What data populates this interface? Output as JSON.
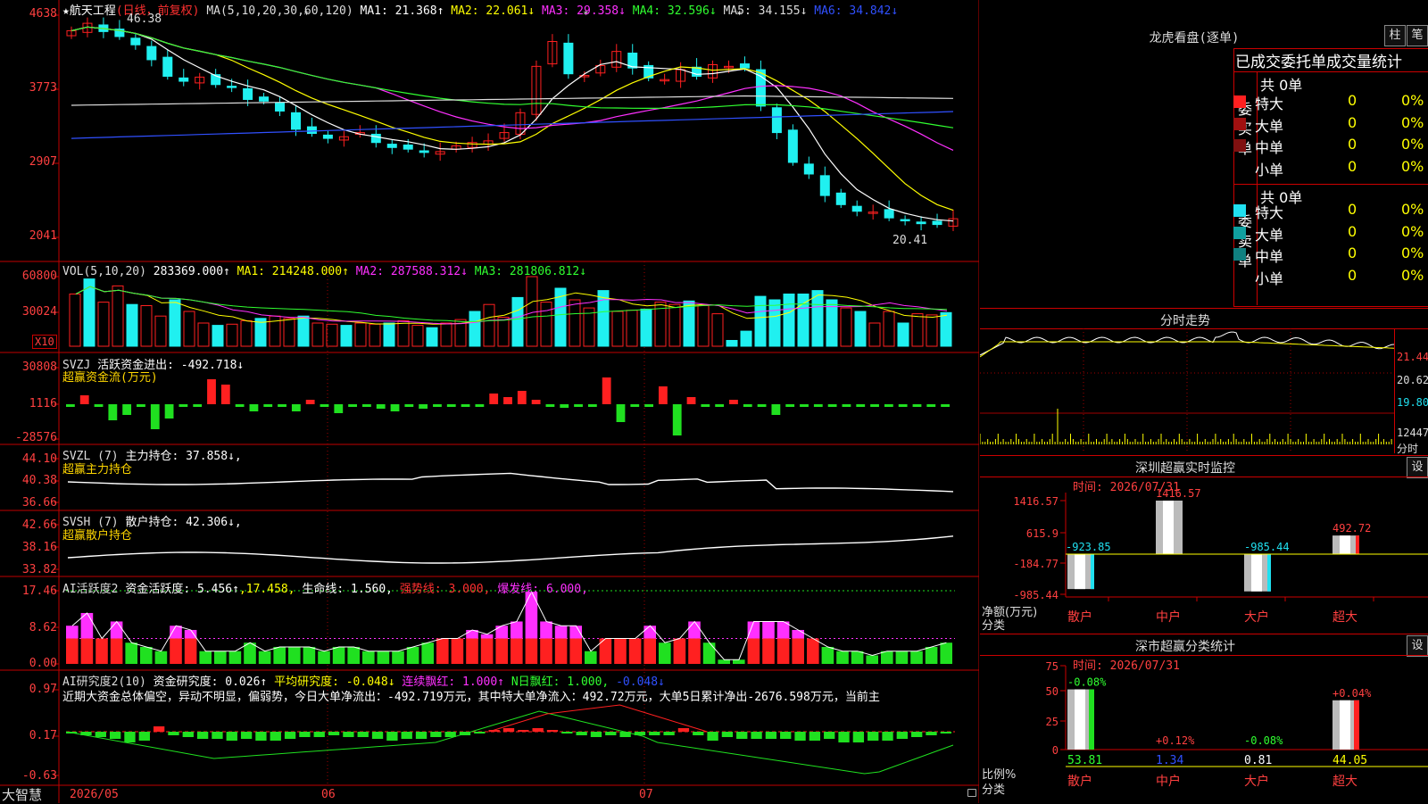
{
  "app": {
    "logo": "大智慧"
  },
  "main_chart": {
    "title_star": "★",
    "stock_name": "航天工程",
    "period": "(日线，前复权)",
    "ma_label": "MA(5,10,20,30,60,120)",
    "ma1": "MA1: 21.368↑",
    "ma2": "MA2: 22.061↓",
    "ma3": "MA3: 29.358↓",
    "ma4": "MA4: 32.596↓",
    "ma5": "MA5: 34.155↓",
    "ma6": "MA6: 34.842↓",
    "high_label": "46.38",
    "low_label": "20.41",
    "y_ticks": [
      "4638",
      "3773",
      "2907",
      "2041"
    ]
  },
  "volume": {
    "label": "VOL(5,10,20)",
    "value": "283369.000↑",
    "ma1": "MA1: 214248.000↑",
    "ma2": "MA2: 287588.312↓",
    "ma3": "MA3: 281806.812↓",
    "y_ticks": [
      "60800",
      "30024"
    ],
    "unit": "X10"
  },
  "svzj": {
    "label": "SVZJ",
    "desc": "活跃资金进出: -492.718↓",
    "sub": "超赢资金流(万元)",
    "y_ticks": [
      "30808",
      "1116",
      "-28576"
    ]
  },
  "svzl": {
    "label": "SVZL (7)",
    "desc": "主力持仓: 37.858↓,",
    "sub": "超赢主力持仓",
    "y_ticks": [
      "44.10",
      "40.38",
      "36.66"
    ]
  },
  "svsh": {
    "label": "SVSH (7)",
    "desc": "散户持仓: 42.306↓,",
    "sub": "超赢散户持仓",
    "y_ticks": [
      "42.66",
      "38.16",
      "33.82"
    ]
  },
  "ai_active": {
    "label": "AI活跃度2",
    "desc": "资金活跃度: 5.456↑",
    "v2": ",17.458,",
    "life": "生命线: 1.560,",
    "strong": "强势线: 3.000,",
    "burst": "爆发线: 6.000,",
    "y_ticks": [
      "17.46",
      "8.62",
      "0.00"
    ]
  },
  "ai_research": {
    "label": "AI研究度2(10)",
    "desc": "资金研究度: 0.026↑",
    "avg": "平均研究度: -0.048↓",
    "cont": "连续飘红: 1.000↑",
    "nday": "N日飘红: 1.000,",
    "last": "-0.048↓",
    "note": "近期大资金总体偏空，异动不明显，偏弱势，今日大单净流出：-492.719万元，其中特大单净流入：492.72万元，大单5日累计净出-2676.598万元，当前主",
    "y_ticks": [
      "0.97",
      "0.17",
      "-0.63"
    ]
  },
  "x_axis": {
    "labels": [
      "2026/05",
      "06",
      "07"
    ]
  },
  "dragon_tiger": {
    "title": "龙虎看盘(逐单)",
    "btn_zhu": "柱",
    "btn_bi": "笔",
    "header": "已成交委托单成交量统计",
    "buy": {
      "side_label": "委买单",
      "total": "共 0单",
      "rows": [
        {
          "name": "特大",
          "n": "0",
          "pct": "0%"
        },
        {
          "name": "大单",
          "n": "0",
          "pct": "0%"
        },
        {
          "name": "中单",
          "n": "0",
          "pct": "0%"
        },
        {
          "name": "小单",
          "n": "0",
          "pct": "0%"
        }
      ]
    },
    "sell": {
      "side_label": "委卖单",
      "total": "共 0单",
      "rows": [
        {
          "name": "特大",
          "n": "0",
          "pct": "0%"
        },
        {
          "name": "大单",
          "n": "0",
          "pct": "0%"
        },
        {
          "name": "中单",
          "n": "0",
          "pct": "0%"
        },
        {
          "name": "小单",
          "n": "0",
          "pct": "0%"
        }
      ]
    },
    "colors": {
      "buy": [
        "#ff2020",
        "#a01010",
        "#801010"
      ],
      "sell": [
        "#20e0f0",
        "#10a0a0",
        "#108080"
      ]
    }
  },
  "intraday": {
    "title": "分时走势",
    "prices": [
      "21.44",
      "20.62",
      "19.80"
    ],
    "vol": "12447",
    "vol_unit": "分时"
  },
  "sz_monitor": {
    "title": "深圳超赢实时监控",
    "btn": "设",
    "time": "时间: 2026/07/31",
    "y_ticks": [
      "1416.57",
      "615.9",
      "-184.77",
      "-985.44"
    ],
    "axis_label": "净额(万元)",
    "axis_cat": "分类",
    "categories": [
      "散户",
      "中户",
      "大户",
      "超大"
    ],
    "values": [
      -923.85,
      1416.57,
      -985.44,
      492.72
    ],
    "value_labels": [
      "-923.85",
      "1416.57",
      "-985.44",
      "492.72"
    ]
  },
  "sz_classify": {
    "title": "深市超赢分类统计",
    "btn": "设",
    "time": "时间: 2026/07/31",
    "y_ticks": [
      "75",
      "50",
      "25",
      "0"
    ],
    "axis_label": "比例%",
    "axis_cat": "分类",
    "categories": [
      "散户",
      "中户",
      "大户",
      "超大"
    ],
    "ratios": [
      "53.81",
      "1.34",
      "0.81",
      "44.05"
    ],
    "changes": [
      "-0.08%",
      "+0.12%",
      "-0.08%",
      "+0.04%"
    ]
  },
  "chart_data": [
    {
      "type": "candlestick",
      "title": "航天工程 日线",
      "ylim": [
        20.41,
        46.38
      ],
      "y_ticks": [
        46.38,
        37.73,
        29.07,
        20.41
      ],
      "close": [
        44.5,
        45.4,
        44.4,
        43.8,
        42.8,
        41.0,
        39.0,
        38.4,
        38.9,
        38.0,
        37.7,
        36.2,
        36.0,
        34.8,
        32.6,
        32.1,
        31.5,
        31.7,
        32.2,
        31.0,
        30.4,
        30.2,
        29.8,
        29.9,
        30.6,
        31.0,
        31.2,
        32.2,
        34.6,
        40.2,
        43.2,
        39.3,
        39.1,
        40.3,
        42.0,
        40.0,
        38.8,
        38.6,
        39.8,
        39.0,
        40.4,
        40.2,
        40.0,
        35.4,
        32.2,
        28.6,
        27.2,
        24.6,
        23.5,
        22.7,
        22.6,
        21.9,
        21.6,
        21.2,
        21.1,
        21.8
      ],
      "legend": [
        "MA1 21.368",
        "MA2 22.061",
        "MA3 29.358",
        "MA4 32.596",
        "MA5 34.155",
        "MA6 34.842"
      ]
    },
    {
      "type": "bar",
      "title": "VOL(5,10,20)",
      "ylim": [
        0,
        60800
      ],
      "values": [
        45,
        58,
        38,
        52,
        36,
        35,
        26,
        40,
        30,
        20,
        18,
        19,
        22,
        24,
        26,
        24,
        26,
        20,
        19,
        18,
        20,
        19,
        20,
        22,
        18,
        16,
        20,
        23,
        30,
        36,
        25,
        42,
        60,
        38,
        50,
        40,
        33,
        48,
        30,
        31,
        32,
        38,
        36,
        39,
        35,
        28,
        5,
        13,
        43,
        40,
        45,
        45,
        48,
        40,
        33,
        30,
        20,
        30,
        20,
        28,
        27,
        29
      ]
    }
  ]
}
